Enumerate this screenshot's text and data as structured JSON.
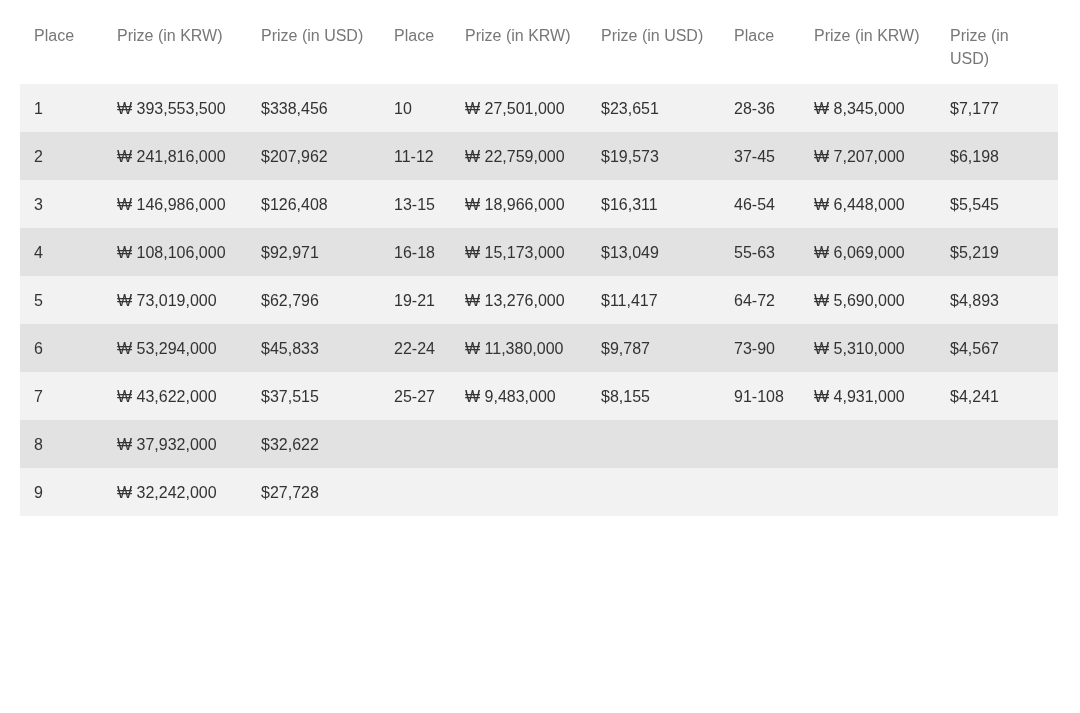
{
  "table": {
    "columns": [
      "Place",
      "Prize (in KRW)",
      "Prize (in USD)",
      "Place",
      "Prize (in KRW)",
      "Prize (in USD)",
      "Place",
      "Prize (in KRW)",
      "Prize (in USD)"
    ],
    "rows": [
      [
        "1",
        "₩ 393,553,500",
        "$338,456",
        "10",
        "₩ 27,501,000",
        "$23,651",
        "28-36",
        "₩ 8,345,000",
        "$7,177"
      ],
      [
        "2",
        "₩ 241,816,000",
        "$207,962",
        "11-12",
        "₩ 22,759,000",
        "$19,573",
        "37-45",
        "₩ 7,207,000",
        "$6,198"
      ],
      [
        "3",
        "₩ 146,986,000",
        "$126,408",
        "13-15",
        "₩ 18,966,000",
        "$16,311",
        "46-54",
        "₩ 6,448,000",
        "$5,545"
      ],
      [
        "4",
        "₩ 108,106,000",
        "$92,971",
        "16-18",
        "₩ 15,173,000",
        "$13,049",
        "55-63",
        "₩ 6,069,000",
        "$5,219"
      ],
      [
        "5",
        "₩ 73,019,000",
        "$62,796",
        "19-21",
        "₩ 13,276,000",
        "$11,417",
        "64-72",
        "₩ 5,690,000",
        "$4,893"
      ],
      [
        "6",
        "₩ 53,294,000",
        "$45,833",
        "22-24",
        "₩ 11,380,000",
        "$9,787",
        "73-90",
        "₩ 5,310,000",
        "$4,567"
      ],
      [
        "7",
        "₩ 43,622,000",
        "$37,515",
        "25-27",
        "₩ 9,483,000",
        "$8,155",
        "91-108",
        "₩ 4,931,000",
        "$4,241"
      ],
      [
        "8",
        "₩ 37,932,000",
        "$32,622"
      ],
      [
        "9",
        "₩ 32,242,000",
        "$27,728"
      ]
    ]
  }
}
